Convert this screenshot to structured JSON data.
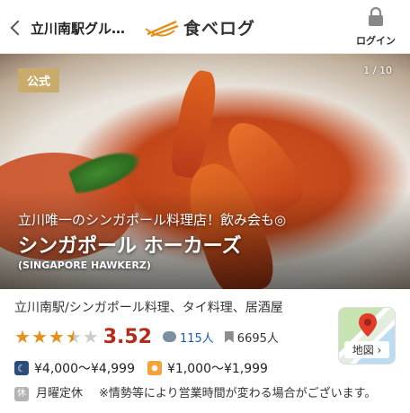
{
  "header": {
    "back_label": "立川南駅グル…",
    "logo_text": "食べログ",
    "login_label": "ログイン"
  },
  "hero": {
    "badge": "公式",
    "counter": "1 / 10",
    "tagline": "立川唯一のシンガポール料理店！飲み会も◎",
    "name": "シンガポール ホーカーズ",
    "name_en": "(SINGAPORE HAWKERZ)"
  },
  "info": {
    "category": "立川南駅/シンガポール料理、タイ料理、居酒屋",
    "rating": "3.52",
    "rating_value": 3.52,
    "reviews": "115人",
    "saves": "6695人",
    "map_label": "地図 ›",
    "dinner_price": "¥4,000〜¥4,999",
    "lunch_price": "¥1,000〜¥1,999",
    "holiday_icon": "休",
    "holiday": "月曜定休",
    "note": "※情勢等により営業時間が変わる場合がございます。"
  },
  "colors": {
    "accent": "#e5901a",
    "score": "#b42b1a",
    "link": "#1a5dab",
    "badge": "#c9ab6b"
  }
}
